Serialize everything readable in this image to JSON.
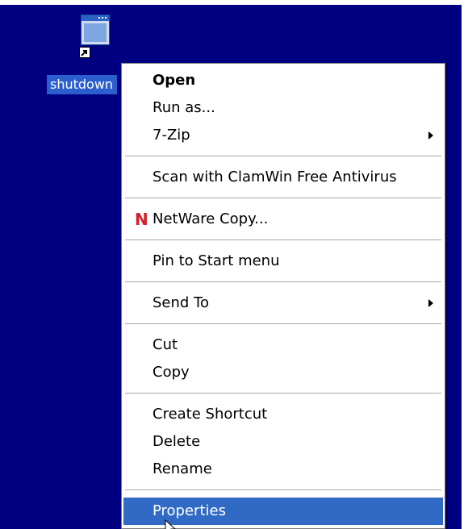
{
  "desktop": {
    "background": "#000080",
    "icon": {
      "label": "shutdown",
      "glyph": "window-icon",
      "overlay": "shortcut-arrow-icon"
    }
  },
  "context_menu": {
    "groups": [
      [
        {
          "label": "Open",
          "bold": true
        },
        {
          "label": "Run as..."
        },
        {
          "label": "7-Zip",
          "submenu": true
        }
      ],
      [
        {
          "label": "Scan with ClamWin Free Antivirus"
        }
      ],
      [
        {
          "label": "NetWare Copy...",
          "icon": "N",
          "icon_name": "netware-icon",
          "icon_color": "#d3202a"
        }
      ],
      [
        {
          "label": "Pin to Start menu"
        }
      ],
      [
        {
          "label": "Send To",
          "submenu": true
        }
      ],
      [
        {
          "label": "Cut"
        },
        {
          "label": "Copy"
        }
      ],
      [
        {
          "label": "Create Shortcut"
        },
        {
          "label": "Delete"
        },
        {
          "label": "Rename"
        }
      ],
      [
        {
          "label": "Properties",
          "highlighted": true
        }
      ]
    ],
    "highlight_color": "#316ac5"
  },
  "cursor": {
    "icon": "arrow-pointer-icon"
  }
}
